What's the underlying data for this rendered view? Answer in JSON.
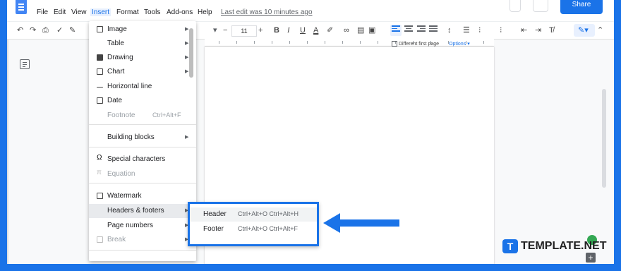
{
  "menubar": {
    "items": [
      "File",
      "Edit",
      "View",
      "Insert",
      "Format",
      "Tools",
      "Add-ons",
      "Help"
    ],
    "active": "Insert",
    "last_edit": "Last edit was 10 minutes ago",
    "share_label": "Share"
  },
  "toolbar": {
    "font_size": "11",
    "icons": [
      "undo-icon",
      "redo-icon",
      "print-icon",
      "spellcheck-icon",
      "paint-format-icon",
      "decrease-font-icon",
      "increase-font-icon",
      "bold-icon",
      "italic-icon",
      "underline-icon",
      "text-color-icon",
      "highlight-icon",
      "link-icon",
      "comment-icon",
      "image-icon",
      "align-left-icon",
      "align-center-icon",
      "align-right-icon",
      "justify-icon",
      "line-spacing-icon",
      "checklist-icon",
      "bulleted-list-icon",
      "numbered-list-icon",
      "decrease-indent-icon",
      "increase-indent-icon",
      "clear-format-icon",
      "edit-mode-icon",
      "collapse-icon"
    ],
    "bold": "B",
    "italic": "I",
    "underline": "U",
    "text_color": "A",
    "minus": "−",
    "plus": "+"
  },
  "header_options": {
    "different_first_page": "Different first page",
    "options": "Options"
  },
  "insert_menu": {
    "items": [
      {
        "label": "Image",
        "icon": "image-icon",
        "submenu": true
      },
      {
        "label": "Table",
        "icon": "",
        "submenu": true
      },
      {
        "label": "Drawing",
        "icon": "drawing-icon",
        "submenu": true
      },
      {
        "label": "Chart",
        "icon": "chart-icon",
        "submenu": true
      },
      {
        "label": "Horizontal line",
        "icon": "horizontal-line-icon",
        "submenu": false
      },
      {
        "label": "Date",
        "icon": "date-icon",
        "submenu": false
      },
      {
        "label": "Footnote",
        "icon": "",
        "submenu": false,
        "shortcut": "Ctrl+Alt+F",
        "disabled": true
      },
      {
        "label": "Building blocks",
        "icon": "",
        "submenu": true
      },
      {
        "label": "Special characters",
        "icon": "omega-icon",
        "submenu": false
      },
      {
        "label": "Equation",
        "icon": "equation-icon",
        "submenu": false,
        "disabled": true
      },
      {
        "label": "Watermark",
        "icon": "watermark-icon",
        "submenu": false
      },
      {
        "label": "Headers & footers",
        "icon": "",
        "submenu": true,
        "highlighted": true
      },
      {
        "label": "Page numbers",
        "icon": "",
        "submenu": true
      },
      {
        "label": "Break",
        "icon": "break-icon",
        "submenu": true,
        "disabled": true
      }
    ]
  },
  "submenu": {
    "items": [
      {
        "label": "Header",
        "shortcut": "Ctrl+Alt+O Ctrl+Alt+H"
      },
      {
        "label": "Footer",
        "shortcut": "Ctrl+Alt+O Ctrl+Alt+F"
      }
    ]
  },
  "watermark": {
    "logo_letter": "T",
    "text": "TEMPLATE.NET"
  },
  "colors": {
    "accent": "#1a73e8",
    "frame": "#1a73e8"
  }
}
